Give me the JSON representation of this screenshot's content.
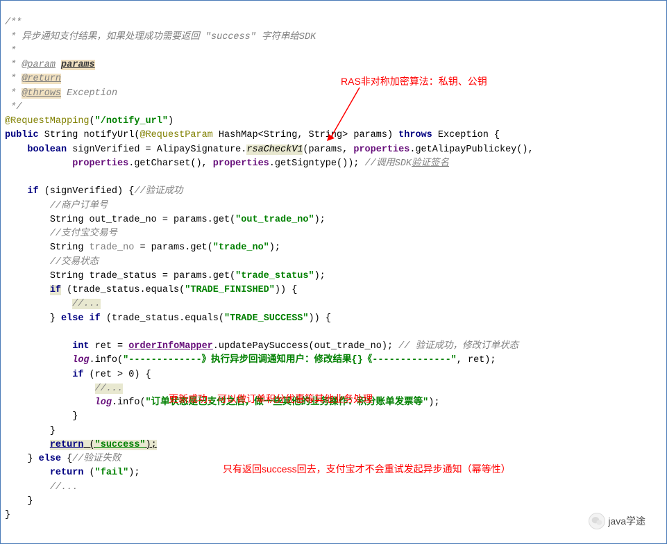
{
  "doc": {
    "line1": "/**",
    "line2_prefix": " * ",
    "line2": "异步通知支付结果，如果处理成功需要返回 \"success\" 字符串给SDK",
    "line3": " *",
    "line4_prefix": " * ",
    "tag_param": "@param",
    "param_name": "params",
    "tag_return": "@return",
    "tag_throws": "@throws",
    "throws_type": "Exception",
    "close": " */"
  },
  "anno": {
    "request_mapping": "@RequestMapping",
    "request_mapping_path": "\"/notify_url\"",
    "request_param": "@RequestParam"
  },
  "kw": {
    "public": "public",
    "boolean": "boolean",
    "throws": "throws",
    "if": "if",
    "else": "else",
    "else_if": "else if",
    "return": "return",
    "int": "int"
  },
  "code": {
    "return_type": "String",
    "method_name": "notifyUrl",
    "param_type": "HashMap<String, String>",
    "param_name": "params",
    "exception": "Exception",
    "signVerified": "signVerified",
    "alipay_sig": "AlipaySignature",
    "rsa_method": "rsaCheckV1",
    "rsa_args1": "(params, ",
    "properties": "properties",
    "getAlipayPublickey": ".getAlipayPublickey(),",
    "getCharset": ".getCharset(), ",
    "getSigntype": ".getSigntype());",
    "verify_comment": "//调用SDK",
    "verify_comment_u": "验证签名",
    "verify_success": "//验证成功",
    "merchant_order": "//商户订单号",
    "out_trade_no_decl": "String out_trade_no = params.get(",
    "out_trade_no_str": "\"out_trade_no\"",
    "alipay_trade_no": "//支付宝交易号",
    "trade_no_decl": "String ",
    "trade_no_var": "trade_no",
    "trade_no_rest": " = params.get(",
    "trade_no_str": "\"trade_no\"",
    "trade_status_comment": "//交易状态",
    "trade_status_decl": "String trade_status = params.get(",
    "trade_status_str": "\"trade_status\"",
    "trade_status_eq": "(trade_status.equals(",
    "trade_finished_str": "\"TRADE_FINISHED\"",
    "ellipsis": "//...",
    "trade_success_str": "\"TRADE_SUCCESS\"",
    "ret_var": "ret",
    "order_mapper": "orderInfoMapper",
    "update_method": ".updatePaySuccess(out_trade_no);",
    "update_comment": "// 验证成功，修改订单状态",
    "log": "log",
    "log_info1": ".info(",
    "log_str1": "\"-------------》执行异步回调通知用户：修改结果{}《--------------\"",
    "log_args1": ", ret);",
    "if_ret": "(ret > 0) {",
    "log_str2": "\"订单状态是已支付之后，做一些其他的业务操作：积分账单发票等\"",
    "success_str": "\"success\"",
    "verify_fail": "//验证失败",
    "fail_str": "\"fail\""
  },
  "red": {
    "rsa_note": "RAS非对称加密算法：私钥、公钥",
    "update_note": "更新成功，可以做订单积分优惠等其他业务处理",
    "success_note": "只有返回success回去，支付宝才不会重试发起异步通知（幂等性）"
  },
  "watermark": {
    "text": "java学途"
  }
}
